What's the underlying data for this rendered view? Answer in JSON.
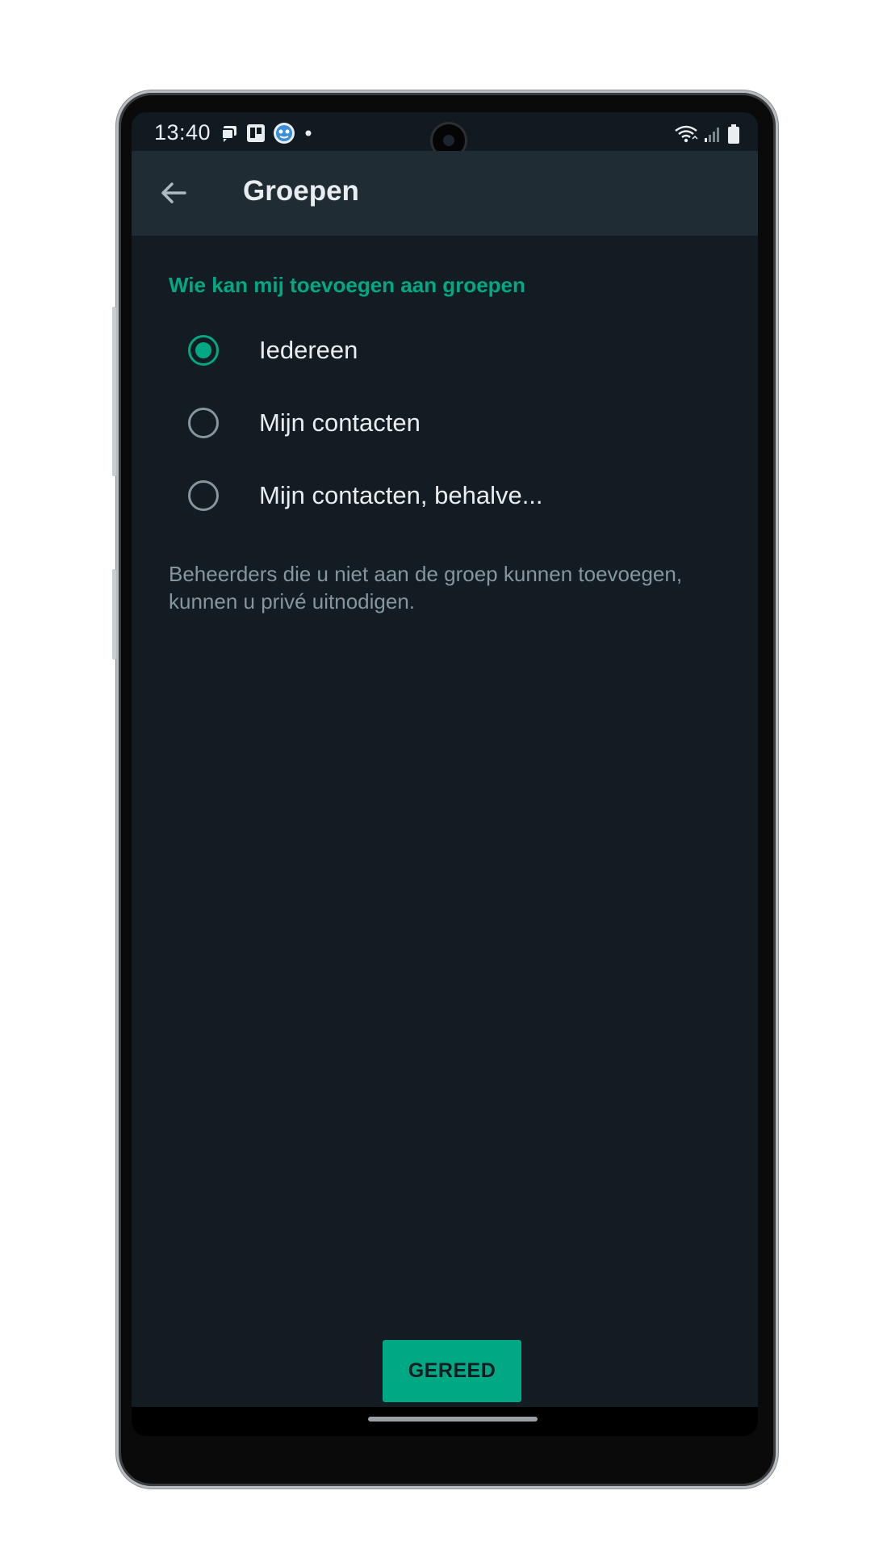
{
  "status_bar": {
    "time": "13:40",
    "notification_icons": [
      "chat-icon",
      "trello-icon",
      "app-face-icon",
      "dot-icon"
    ],
    "system_icons": [
      "wifi-icon",
      "signal-icon",
      "battery-icon"
    ]
  },
  "app_bar": {
    "back_icon": "arrow-left-icon",
    "title": "Groepen"
  },
  "section": {
    "header": "Wie kan mij toevoegen aan groepen"
  },
  "options": [
    {
      "label": "Iedereen",
      "selected": true
    },
    {
      "label": "Mijn contacten",
      "selected": false
    },
    {
      "label": "Mijn contacten, behalve...",
      "selected": false
    }
  ],
  "hint": "Beheerders die u niet aan de groep kunnen toevoegen, kunnen u privé uitnodigen.",
  "footer": {
    "done_label": "GEREED"
  },
  "colors": {
    "accent": "#00a884",
    "background": "#121c22",
    "app_bar": "#1f2c34"
  }
}
